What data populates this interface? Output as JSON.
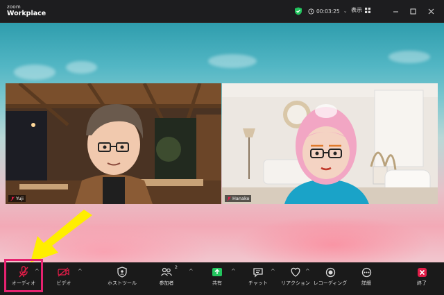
{
  "titlebar": {
    "brand_small": "zoom",
    "brand_main": "Workplace",
    "timer": "00:03:25",
    "view_label": "表示"
  },
  "participants": [
    {
      "name": "Yuji"
    },
    {
      "name": "Hanako"
    }
  ],
  "toolbar": {
    "audio": "オーディオ",
    "video": "ビデオ",
    "host_tools": "ホストツール",
    "participants": "参加者",
    "participants_count": "2",
    "share": "共有",
    "chat": "チャット",
    "reactions": "リアクション",
    "recording": "レコーディング",
    "more": "詳細",
    "end": "終了"
  },
  "colors": {
    "highlight": "#e6226f",
    "arrow": "#ffee00",
    "share_green": "#22c55e",
    "end_red": "#e11d48",
    "shield_green": "#22c55e"
  }
}
